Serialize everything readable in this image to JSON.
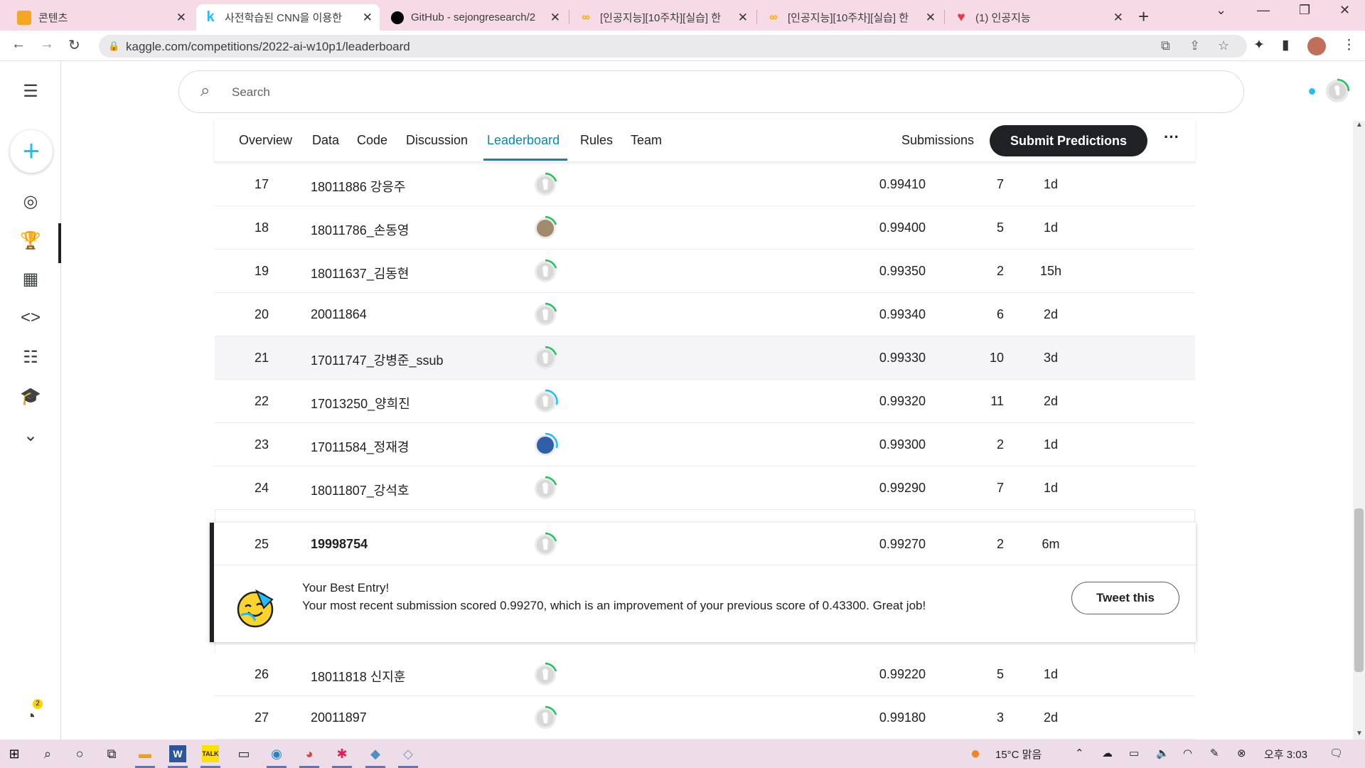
{
  "browser": {
    "tabs": [
      {
        "title": "콘텐츠",
        "icon": "notebook-icon",
        "color": "#f5a623"
      },
      {
        "title": "사전학습된 CNN을 이용한",
        "icon": "kaggle-k-icon",
        "color": "#20beff"
      },
      {
        "title": "GitHub - sejongresearch/2",
        "icon": "github-icon",
        "color": "#000000"
      },
      {
        "title": "[인공지능][10주차][실습] 한",
        "icon": "colab-icon",
        "color": "#f9ab00"
      },
      {
        "title": "[인공지능][10주차][실습] 한",
        "icon": "colab-icon",
        "color": "#f9ab00"
      },
      {
        "title": "(1) 인공지능",
        "icon": "heart-icon",
        "color": "#e53950"
      }
    ],
    "url": "kaggle.com/competitions/2022-ai-w10p1/leaderboard"
  },
  "search": {
    "placeholder": "Search"
  },
  "comp_tabs": {
    "overview": "Overview",
    "data": "Data",
    "code": "Code",
    "discussion": "Discussion",
    "leaderboard": "Leaderboard",
    "rules": "Rules",
    "team": "Team",
    "submissions": "Submissions",
    "submit": "Submit Predictions"
  },
  "rows_top": [
    {
      "rank": "17",
      "team": "18011886 강응주",
      "score": "0.99410",
      "entries": "7",
      "last": "1d",
      "avatar": "default"
    },
    {
      "rank": "18",
      "team": "18011786_손동영",
      "score": "0.99400",
      "entries": "5",
      "last": "1d",
      "avatar": "photo"
    },
    {
      "rank": "19",
      "team": "18011637_김동현",
      "score": "0.99350",
      "entries": "2",
      "last": "15h",
      "avatar": "default"
    },
    {
      "rank": "20",
      "team": "20011864",
      "score": "0.99340",
      "entries": "6",
      "last": "2d",
      "avatar": "default"
    },
    {
      "rank": "21",
      "team": "17011747_강병준_ssub",
      "score": "0.99330",
      "entries": "10",
      "last": "3d",
      "avatar": "default"
    },
    {
      "rank": "22",
      "team": "17013250_양희진",
      "score": "0.99320",
      "entries": "11",
      "last": "2d",
      "avatar": "default-blue"
    },
    {
      "rank": "23",
      "team": "17011584_정재경",
      "score": "0.99300",
      "entries": "2",
      "last": "1d",
      "avatar": "photo-blue"
    },
    {
      "rank": "24",
      "team": "18011807_강석호",
      "score": "0.99290",
      "entries": "7",
      "last": "1d",
      "avatar": "default"
    }
  ],
  "best_entry": {
    "rank": "25",
    "team": "19998754",
    "score": "0.99270",
    "entries": "2",
    "last": "6m",
    "title": "Your Best Entry!",
    "message": "Your most recent submission scored 0.99270, which is an improvement of your previous score of 0.43300. Great job!",
    "tweet": "Tweet this"
  },
  "rows_bottom": [
    {
      "rank": "26",
      "team": "18011818 신지훈",
      "score": "0.99220",
      "entries": "5",
      "last": "1d",
      "avatar": "default"
    },
    {
      "rank": "27",
      "team": "20011897",
      "score": "0.99180",
      "entries": "3",
      "last": "2d",
      "avatar": "default"
    }
  ],
  "taskbar": {
    "weather": "15°C 맑음",
    "time": "오후 3:03"
  },
  "notification_count": "2",
  "colors": {
    "accent": "#008abc",
    "kaggle_blue": "#20beff",
    "progress_green": "#20c45c",
    "dark": "#202124"
  }
}
